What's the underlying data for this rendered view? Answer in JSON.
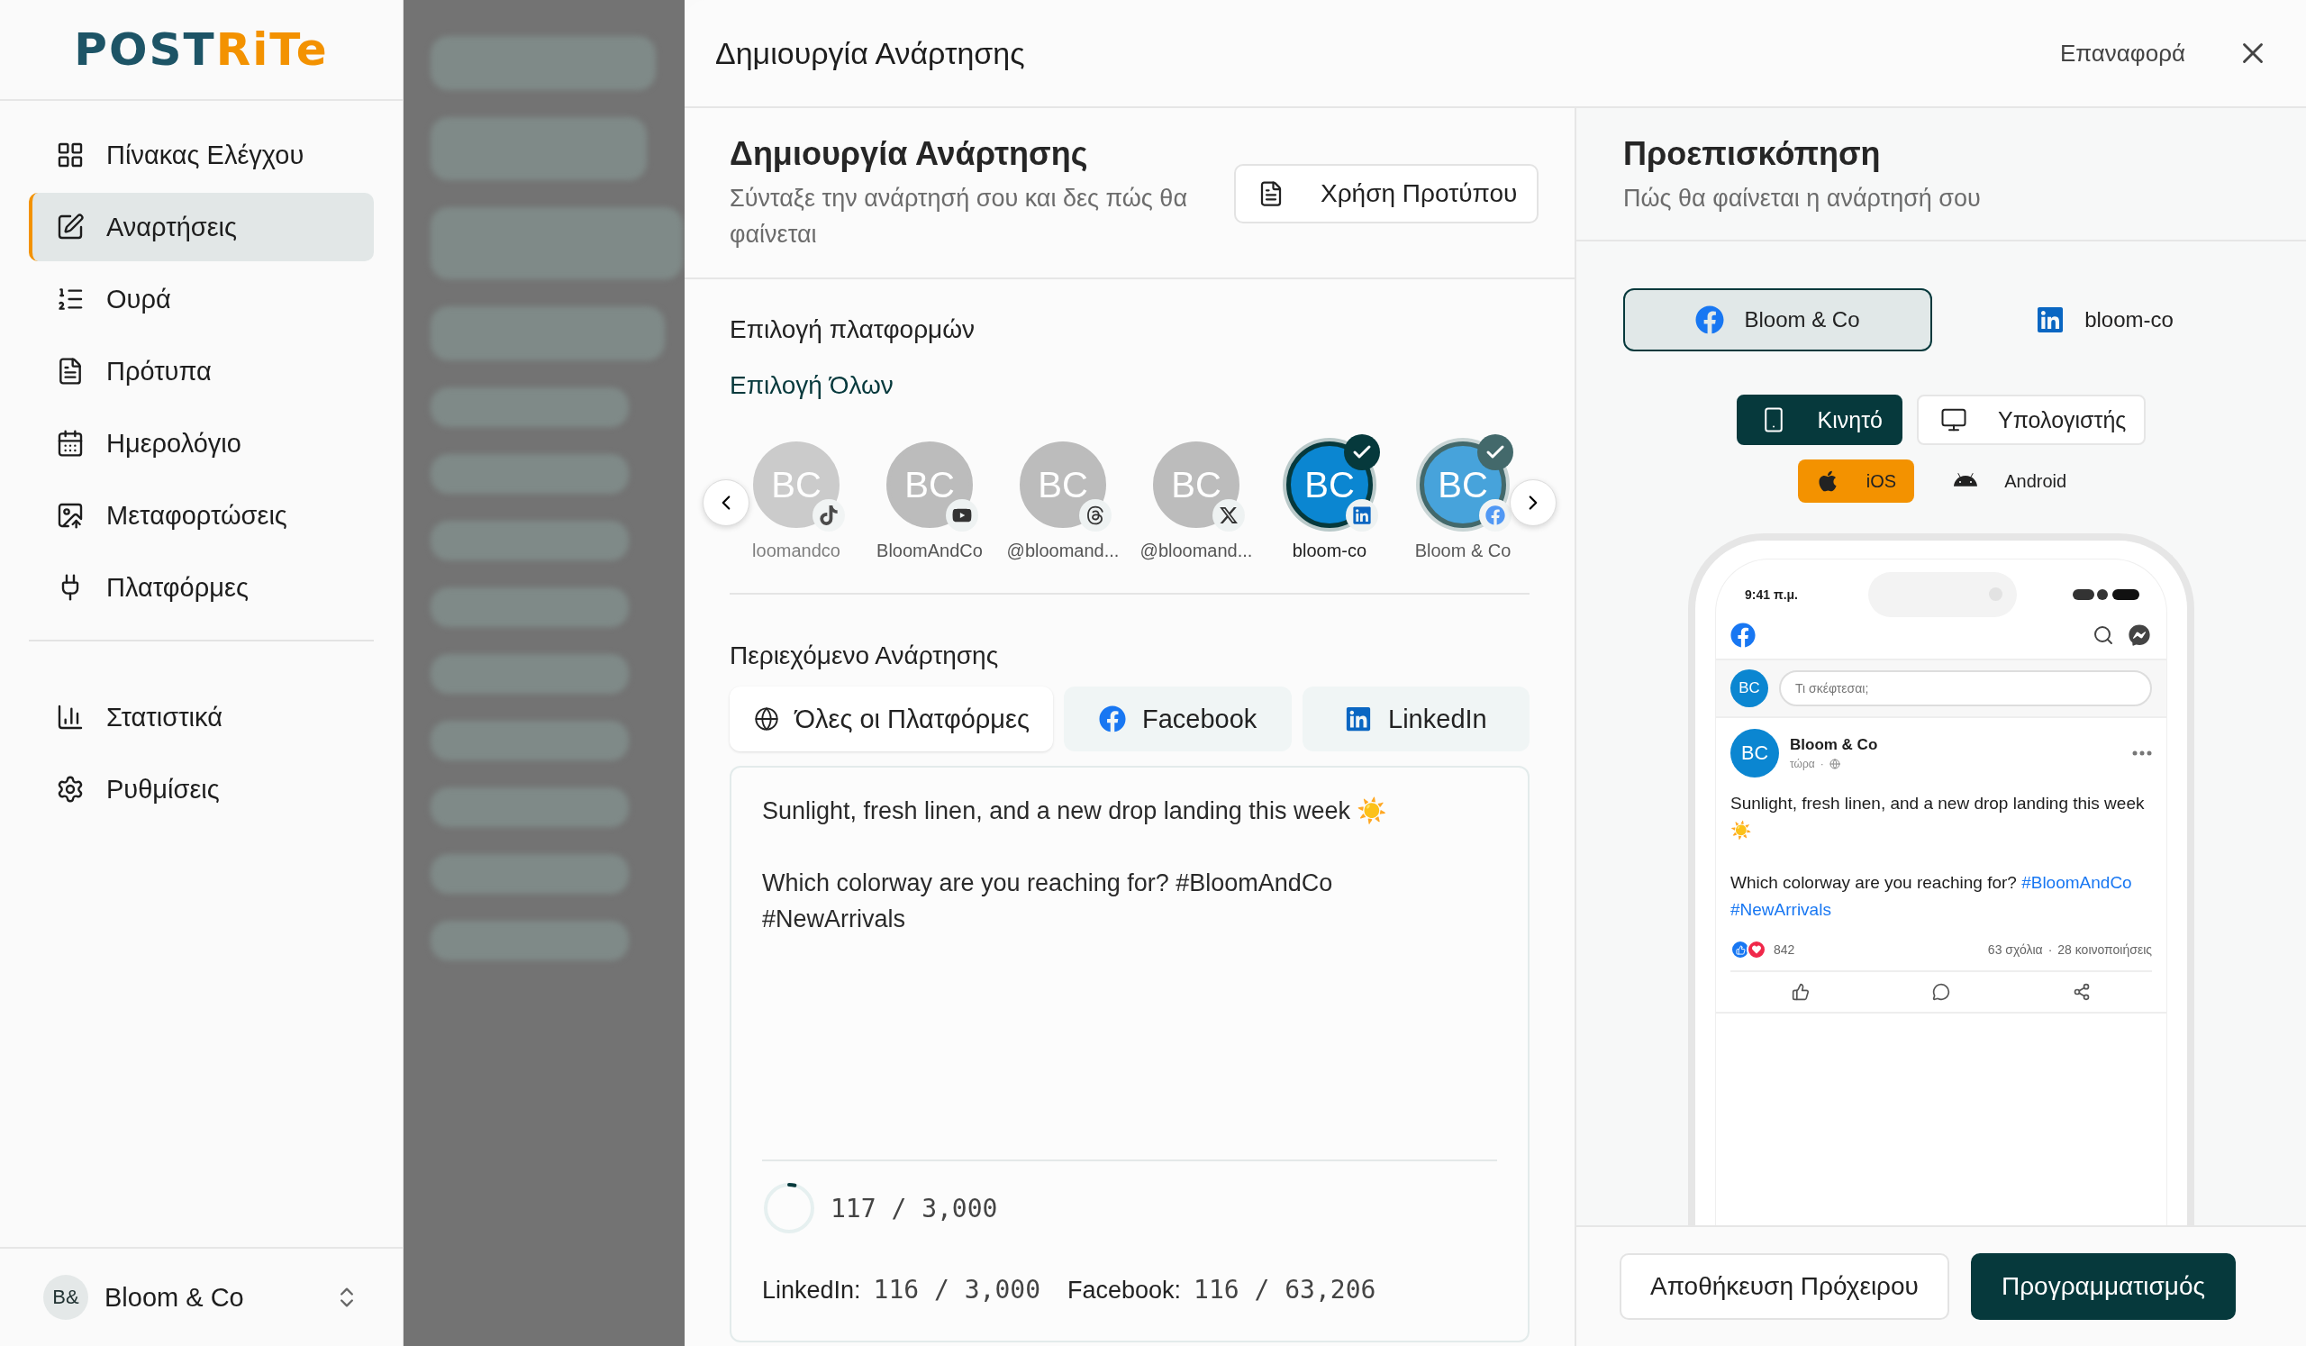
{
  "sidebar": {
    "logo": {
      "dark": "POST",
      "accent": "RiTe"
    },
    "nav_groups": [
      [
        {
          "label": "Πίνακας Ελέγχου",
          "kind": "dashboard",
          "selected": false
        },
        {
          "label": "Αναρτήσεις",
          "kind": "edit",
          "selected": true
        },
        {
          "label": "Ουρά",
          "kind": "queue",
          "selected": false
        },
        {
          "label": "Πρότυπα",
          "kind": "template",
          "selected": false
        },
        {
          "label": "Ημερολόγιο",
          "kind": "calendar",
          "selected": false
        },
        {
          "label": "Μεταφορτώσεις",
          "kind": "upload",
          "selected": false
        },
        {
          "label": "Πλατφόρμες",
          "kind": "plug",
          "selected": false
        }
      ],
      [
        {
          "label": "Στατιστικά",
          "kind": "stats",
          "selected": false
        },
        {
          "label": "Ρυθμίσεις",
          "kind": "settings",
          "selected": false
        }
      ]
    ],
    "account": {
      "initials": "B&",
      "name": "Bloom & Co"
    }
  },
  "modal": {
    "title": "Δημιουργία Ανάρτησης",
    "reset": "Επαναφορά"
  },
  "composer": {
    "title": "Δημιουργία Ανάρτησης",
    "subtitle": "Σύνταξε την ανάρτησή σου και δες πώς θα φαίνεται",
    "template_button": "Χρήση Προτύπου"
  },
  "platforms": {
    "label": "Επιλογή πλατφορμών",
    "select_all": "Επιλογή Όλων",
    "accounts": [
      {
        "initials": "BC",
        "label": "loomandco",
        "kind": "tiktok",
        "selected": false
      },
      {
        "initials": "BC",
        "label": "BloomAndCo",
        "kind": "youtube",
        "selected": false
      },
      {
        "initials": "BC",
        "label": "@bloomand...",
        "kind": "threads",
        "selected": false
      },
      {
        "initials": "BC",
        "label": "@bloomand...",
        "kind": "x",
        "selected": false
      },
      {
        "initials": "BC",
        "label": "bloom-co",
        "kind": "linkedin",
        "selected": true
      },
      {
        "initials": "BC",
        "label": "Bloom & Co",
        "kind": "facebook",
        "selected": true
      }
    ]
  },
  "content": {
    "label": "Περιεχόμενο Ανάρτησης",
    "tabs": [
      {
        "label": "Όλες οι Πλατφόρμες",
        "kind": "all",
        "selected": true
      },
      {
        "label": "Facebook",
        "kind": "facebook",
        "selected": false
      },
      {
        "label": "LinkedIn",
        "kind": "linkedin",
        "selected": false
      }
    ],
    "paragraphs": [
      "Sunlight, fresh linen, and a new drop landing this week ☀️",
      "Which colorway are you reaching for? #BloomAndCo #NewArrivals"
    ],
    "counter": {
      "reading": "117 / 3,000",
      "level": 0.04
    },
    "limits": [
      {
        "name": "LinkedIn:",
        "reading": "116 / 3,000"
      },
      {
        "name": "Facebook:",
        "reading": "116 / 63,206"
      }
    ]
  },
  "preview": {
    "title": "Προεπισκόπηση",
    "subtitle": "Πώς θα φαίνεται η ανάρτησή σου",
    "accounts": [
      {
        "label": "Bloom & Co",
        "kind": "facebook",
        "selected": true
      },
      {
        "label": "bloom-co",
        "kind": "linkedin",
        "selected": false
      }
    ],
    "devices": [
      {
        "label": "Κινητό",
        "kind": "mobile",
        "selected": true
      },
      {
        "label": "Υπολογιστής",
        "kind": "desktop",
        "selected": false
      }
    ],
    "systems": [
      {
        "label": "iOS",
        "kind": "ios",
        "selected": true
      },
      {
        "label": "Android",
        "kind": "android",
        "selected": false
      }
    ],
    "phone": {
      "time": "9:41 π.μ.",
      "avatar": "BC",
      "placeholder": "Τι σκέφτεσαι;",
      "post": {
        "avatar": "BC",
        "author": "Bloom & Co",
        "time": "τώρα",
        "text": "Sunlight, fresh linen, and a new drop landing this week ☀️",
        "question": "Which colorway are you reaching for?",
        "hashtags": [
          "#BloomAndCo",
          "#NewArrivals"
        ],
        "time_separator": "·",
        "reactions": "842",
        "comments": "63 σχόλια",
        "stats_separator": "·",
        "shares": "28 κοινοποιήσεις"
      }
    }
  },
  "footer": {
    "buttons": [
      {
        "label": "Αποθήκευση Πρόχειρου",
        "kind": "secondary"
      },
      {
        "label": "Προγραμματισμός",
        "kind": "primary"
      }
    ]
  }
}
